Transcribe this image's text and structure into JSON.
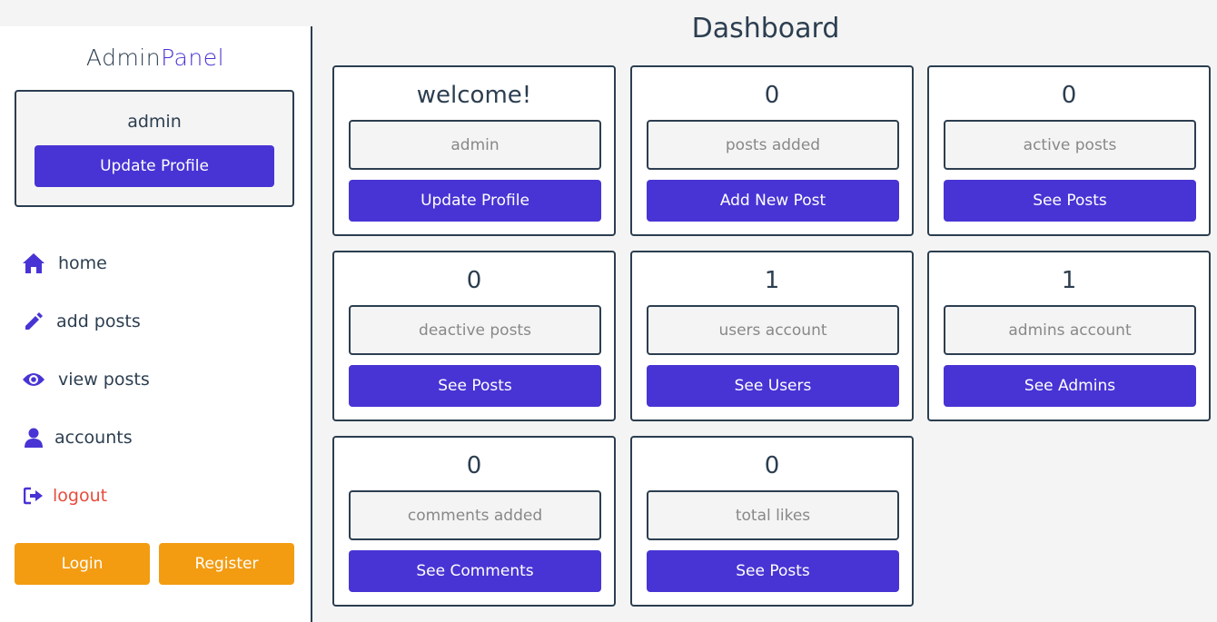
{
  "header": {
    "title": "Dashboard"
  },
  "sidebar": {
    "logo": {
      "part1": "Admin",
      "part2": "Panel"
    },
    "profile": {
      "name": "admin",
      "button_label": "Update Profile"
    },
    "nav": [
      {
        "label": "home",
        "icon": "home-icon"
      },
      {
        "label": "add posts",
        "icon": "pencil-icon"
      },
      {
        "label": "view posts",
        "icon": "eye-icon"
      },
      {
        "label": "accounts",
        "icon": "user-icon"
      },
      {
        "label": "logout",
        "icon": "logout-icon"
      }
    ],
    "login_label": "Login",
    "register_label": "Register"
  },
  "cards": [
    {
      "title": "welcome!",
      "field": "admin",
      "button": "Update Profile"
    },
    {
      "title": "0",
      "field": "posts added",
      "button": "Add New Post"
    },
    {
      "title": "0",
      "field": "active posts",
      "button": "See Posts"
    },
    {
      "title": "0",
      "field": "deactive posts",
      "button": "See Posts"
    },
    {
      "title": "1",
      "field": "users account",
      "button": "See Users"
    },
    {
      "title": "1",
      "field": "admins account",
      "button": "See Admins"
    },
    {
      "title": "0",
      "field": "comments added",
      "button": "See Comments"
    },
    {
      "title": "0",
      "field": "total likes",
      "button": "See Posts"
    }
  ],
  "colors": {
    "accent": "#4834d4",
    "dark": "#2c3e50",
    "orange": "#f39c12",
    "danger": "#e74c3c",
    "bg": "#f4f4f4"
  }
}
